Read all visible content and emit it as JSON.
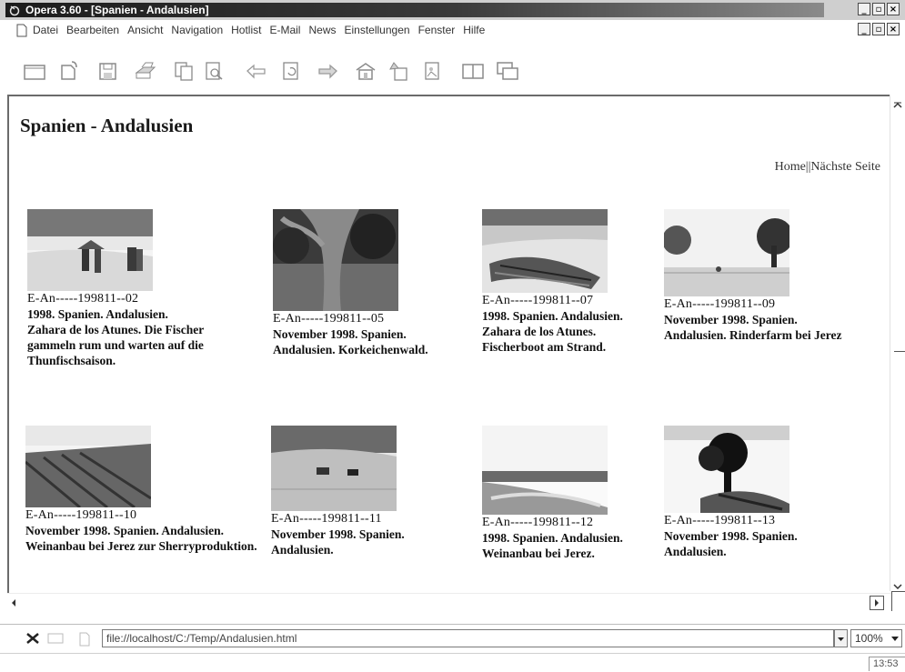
{
  "window": {
    "title": "Opera 3.60 - [Spanien - Andalusien]"
  },
  "menu": {
    "items": [
      "Datei",
      "Bearbeiten",
      "Ansicht",
      "Navigation",
      "Hotlist",
      "E-Mail",
      "News",
      "Einstellungen",
      "Fenster",
      "Hilfe"
    ]
  },
  "toolbar": {
    "icons": [
      "new-window-icon",
      "open-icon",
      "save-icon",
      "print-icon",
      "copy-icon",
      "preview-icon",
      "back-icon",
      "reload-icon",
      "forward-icon",
      "home-icon",
      "hotlist-icon",
      "images-icon",
      "tile-icon",
      "cascade-icon"
    ]
  },
  "page": {
    "title": "Spanien - Andalusien",
    "nav": {
      "home": "Home",
      "separator": "|",
      "next": "|Nächste Seite"
    },
    "items": [
      {
        "code": "E-An-----199811--02",
        "caption": "1998. Spanien. Andalusien. Zahara de los Atunes. Die Fischer gammeln rum und warten auf die Thunfischsaison."
      },
      {
        "code": "E-An-----199811--05",
        "caption": "November 1998. Spanien. Andalusien. Korkeichenwald."
      },
      {
        "code": "E-An-----199811--07",
        "caption": "1998. Spanien. Andalusien. Zahara de los Atunes. Fischerboot am Strand."
      },
      {
        "code": "E-An-----199811--09",
        "caption": "November 1998. Spanien. Andalusien. Rinderfarm bei Jerez"
      },
      {
        "code": "E-An-----199811--10",
        "caption": "November 1998. Spanien. Andalusien. Weinanbau bei Jerez zur Sherryproduktion."
      },
      {
        "code": "E-An-----199811--11",
        "caption": "November 1998. Spanien. Andalusien."
      },
      {
        "code": "E-An-----199811--12",
        "caption": "1998. Spanien. Andalusien. Weinanbau bei Jerez."
      },
      {
        "code": "E-An-----199811--13",
        "caption": "November 1998. Spanien. Andalusien."
      }
    ]
  },
  "status": {
    "url": "file://localhost/C:/Temp/Andalusien.html",
    "zoom": "100%",
    "clock": "13:53"
  }
}
